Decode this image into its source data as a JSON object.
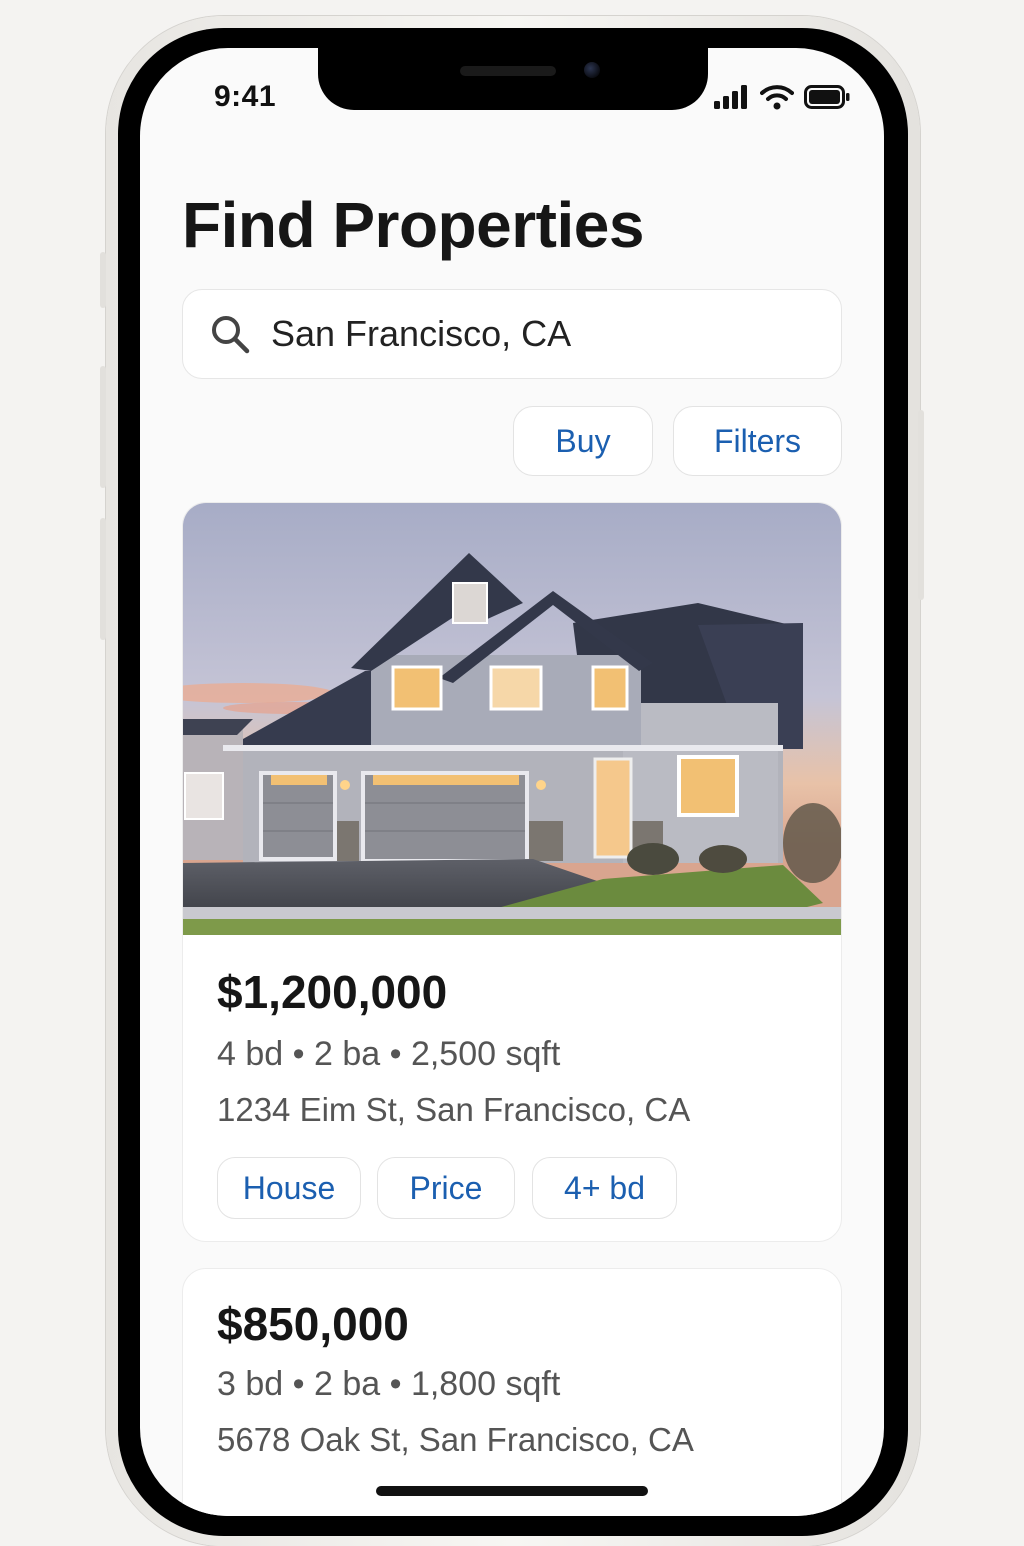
{
  "status_bar": {
    "time": "9:41"
  },
  "header": {
    "title": "Find Properties"
  },
  "search": {
    "value": "San Francisco, CA"
  },
  "actions": {
    "buy_label": "Buy",
    "filters_label": "Filters"
  },
  "listings": [
    {
      "price": "$1,200,000",
      "specs": "4 bd • 2 ba • 2,500 sqft",
      "address": "1234 Eim St, San Francisco,  CA",
      "tags": [
        "House",
        "Price",
        "4+ bd"
      ]
    },
    {
      "price": "$850,000",
      "specs": "3 bd • 2 ba • 1,800 sqft",
      "address": "5678 Oak St, San Francisco, CA"
    }
  ],
  "colors": {
    "accent_link": "#1b5fb0",
    "title_text": "#161616",
    "secondary_text": "#555555",
    "screen_bg": "#fafafa"
  },
  "icons": [
    "search-icon",
    "signal-icon",
    "wifi-icon",
    "battery-icon",
    "house-photo"
  ]
}
